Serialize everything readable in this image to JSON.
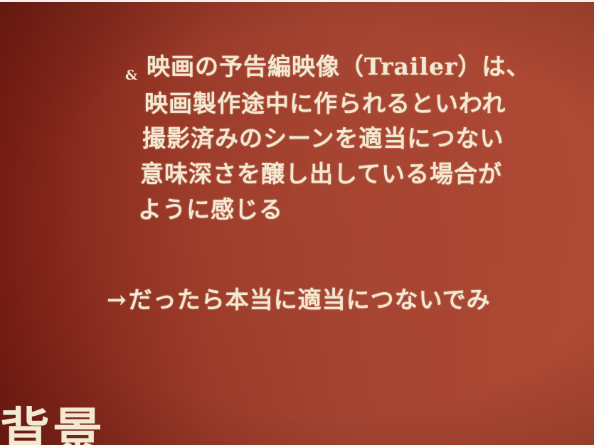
{
  "bullet_symbol": "&",
  "lines": [
    "映画の予告編映像（Trailer）は、",
    "映画製作途中に作られるといわれ",
    "撮影済みのシーンを適当につない",
    "意味深さを醸し出している場合が",
    "ように感じる"
  ],
  "arrow_glyph": "→",
  "conclusion": "だったら本当に適当につないでみ",
  "section_title": "背景"
}
